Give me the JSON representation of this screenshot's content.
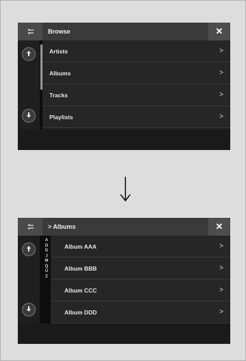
{
  "screen1": {
    "title": "Browse",
    "back_icon": "back-arrow-icon",
    "close_label": "✕",
    "items": [
      {
        "label": "Artists",
        "chevron": ">"
      },
      {
        "label": "Albums",
        "chevron": ">"
      },
      {
        "label": "Tracks",
        "chevron": ">"
      },
      {
        "label": "Playlists",
        "chevron": ">"
      }
    ]
  },
  "transition_arrow": "down-arrow-icon",
  "screen2": {
    "title": "> Albums",
    "back_icon": "back-arrow-icon",
    "close_label": "✕",
    "alpha_index": [
      "A",
      "D",
      "G",
      "J",
      "M",
      "Q",
      "U",
      "Z"
    ],
    "items": [
      {
        "label": "Album AAA",
        "chevron": ">"
      },
      {
        "label": "Album BBB",
        "chevron": ">"
      },
      {
        "label": "Album CCC",
        "chevron": ">"
      },
      {
        "label": "Album DDD",
        "chevron": ">"
      }
    ]
  }
}
